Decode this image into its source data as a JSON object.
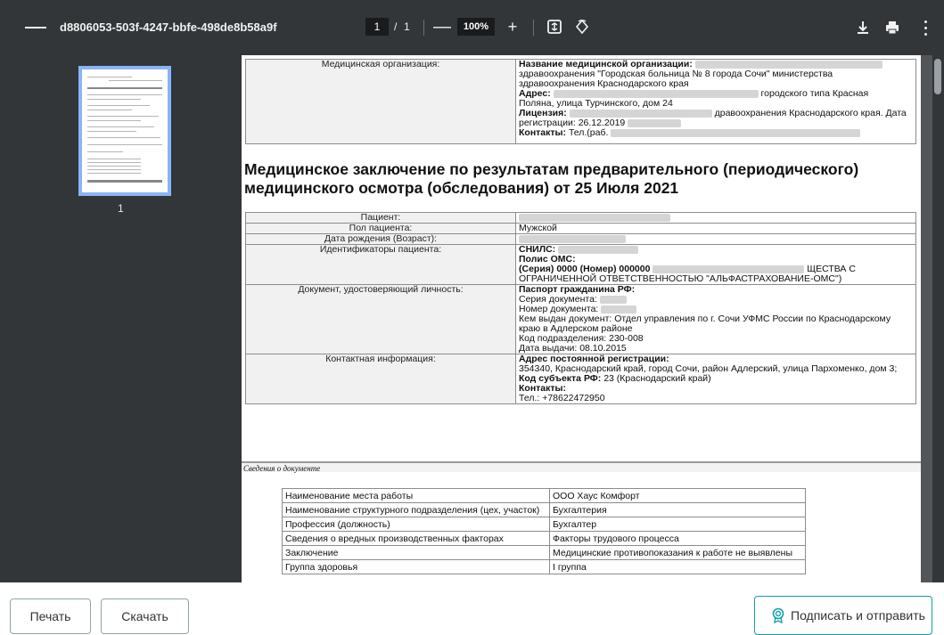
{
  "viewer": {
    "file_title": "d8806053-503f-4247-bbfe-498de8b58a9f",
    "current_page": "1",
    "page_separator": "/",
    "page_total": "1",
    "zoom": "100%",
    "thumbnail_label": "1",
    "icons": {
      "menu": "menu-icon",
      "zoom_out": "minus-icon",
      "zoom_in": "plus-icon",
      "fit": "fit-to-page-icon",
      "rotate": "rotate-icon",
      "download": "download-icon",
      "print": "print-icon",
      "more": "more-vertical-icon"
    }
  },
  "document": {
    "org_label": "Медицинская организация:",
    "org_name_label": "Название медицинской организации:",
    "org_name_value_line2": "здравоохранения \"Городская больница № 8 города Сочи\" министерства",
    "org_name_value_line3": "здравоохранения Краснодарского края",
    "org_address_label": "Адрес:",
    "org_address_value": "городского типа Красная",
    "org_address_value_line2": "Поляна, улица Турчинского, дом 24",
    "org_license_label": "Лицензия:",
    "org_license_value": "дравоохранения Краснодарского края. Дата",
    "org_license_value_line2": "регистрации: 26.12.2019",
    "org_contacts_label": "Контакты:",
    "org_contacts_value": "Тел.(раб.",
    "heading": "Медицинское заключение по результатам предварительного (периодического) медицинского осмотра (обследования) от 25 Июля 2021",
    "patient_label": "Пациент:",
    "sex_label": "Пол пациента:",
    "sex_value": "Мужской",
    "birth_label": "Дата рождения (Возраст):",
    "ids_label": "Идентификаторы пациента:",
    "snils_label": "СНИЛС:",
    "oms_label": "Полис ОМС:",
    "oms_series_label": "(Серия) 0000 (Номер) 000000",
    "oms_value_tail": "ЩЕСТВА С",
    "oms_value_line2": "ОГРАНИЧЕННОЙ ОТВЕТСТВЕННОСТЬЮ \"АЛЬФАСТРАХОВАНИЕ-ОМС\")",
    "id_doc_label": "Документ, удостоверяющий личность:",
    "passport_label": "Паспорт гражданина РФ:",
    "passport_series_label": "Серия документа:",
    "passport_number_label": "Номер документа:",
    "passport_issued_by": "Кем выдан документ: Отдел управления по г. Сочи УФМС России по Краснодарскому",
    "passport_issued_by_line2": "краю в Адлерском районе",
    "passport_division_code": "Код подразделения: 230-008",
    "passport_issue_date": "Дата выдачи: 08.10.2015",
    "contact_label": "Контактная информация:",
    "reg_address_label": "Адрес постоянной регистрации:",
    "reg_address_value": "354340, Краснодарский край, город Сочи, район Адлерский, улица Пархоменко, дом 3;",
    "subject_code_label": "Код субъекта РФ:",
    "subject_code_value": "23 (Краснодарский край)",
    "contacts_label": "Контакты:",
    "phone_value": "Тел.: +78622472950",
    "doc_info_section": "Сведения о документе",
    "work_rows": [
      {
        "label": "Наименование места работы",
        "value": "ООО Хаус Комфорт"
      },
      {
        "label": "Наименование структурного подразделения (цех, участок)",
        "value": "Бухгалтерия"
      },
      {
        "label": "Профессия (должность)",
        "value": "Бухгалтер"
      },
      {
        "label": "Сведения о вредных производственных факторах",
        "value": "Факторы трудового процесса"
      },
      {
        "label": "Заключение",
        "value": "Медицинские противопоказания к работе не выявлены"
      },
      {
        "label": "Группа здоровья",
        "value": "I группа"
      }
    ]
  },
  "actions": {
    "print_label": "Печать",
    "download_label": "Скачать",
    "sign_send_label": "Подписать и отправить",
    "sign_icon": "certificate-icon",
    "accent_color": "#14a0a6"
  }
}
